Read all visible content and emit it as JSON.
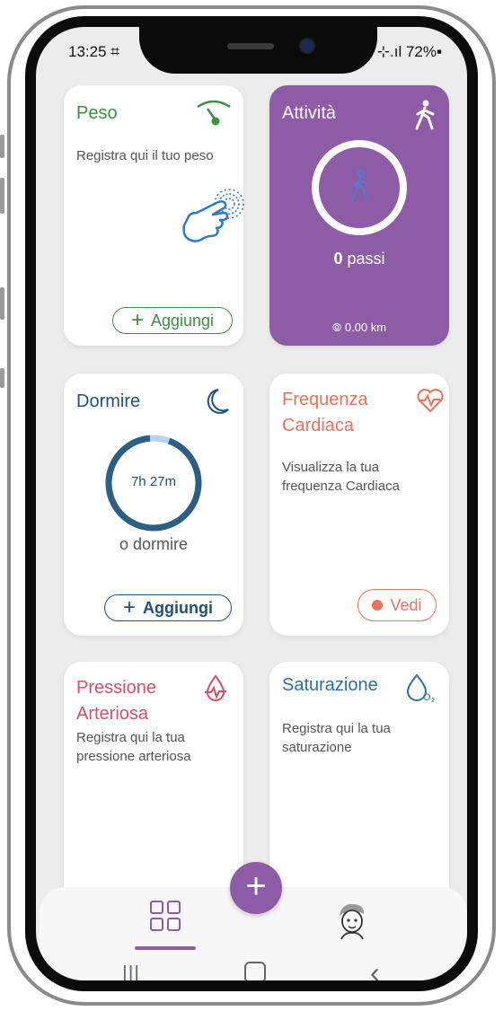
{
  "status": {
    "time": "13:25 ⌗",
    "right": "⊹.ıl 72%▪"
  },
  "cards": {
    "peso": {
      "title": "Peso",
      "desc": "Registra qui il tuo peso",
      "button": "Aggiungi",
      "icon": "gauge-icon",
      "color": "#3d8f45"
    },
    "attivita": {
      "title": "Attività",
      "steps_value": "0",
      "steps_unit": "passi",
      "distance": "0.00 km",
      "icon": "walker-icon",
      "bg": "#8e5ba6"
    },
    "dormire": {
      "title": "Dormire",
      "duration": "7h 27m",
      "sub": "o dormire",
      "button": "Aggiungi",
      "icon": "moon-icon",
      "color": "#1e5277",
      "progress": 0.93
    },
    "frequenza": {
      "title_line1": "Frequenza",
      "title_line2": "Cardiaca",
      "desc_line1": "Visualizza la tua",
      "desc_line2": "frequenza Cardiaca",
      "button": "Vedi",
      "icon": "heart-pulse-icon",
      "color": "#e8735a"
    },
    "pressione": {
      "title_line1": "Pressione",
      "title_line2": "Arteriosa",
      "desc_line1": "Registra qui la tua",
      "desc_line2": "pressione arteriosa",
      "icon": "drop-pulse-icon",
      "color": "#d25168"
    },
    "saturazione": {
      "title": "Saturazione",
      "desc_line1": "Registra qui la tua",
      "desc_line2": "saturazione",
      "icon": "oxygen-drop-icon",
      "color": "#2d6fa3"
    }
  },
  "nav": {
    "fab_label": "+",
    "fab_color": "#8e5ba6",
    "items": [
      "grid-icon",
      "profile-avatar-icon"
    ]
  },
  "system_nav": {
    "recents": "|||",
    "home": "▢",
    "back": "‹"
  }
}
